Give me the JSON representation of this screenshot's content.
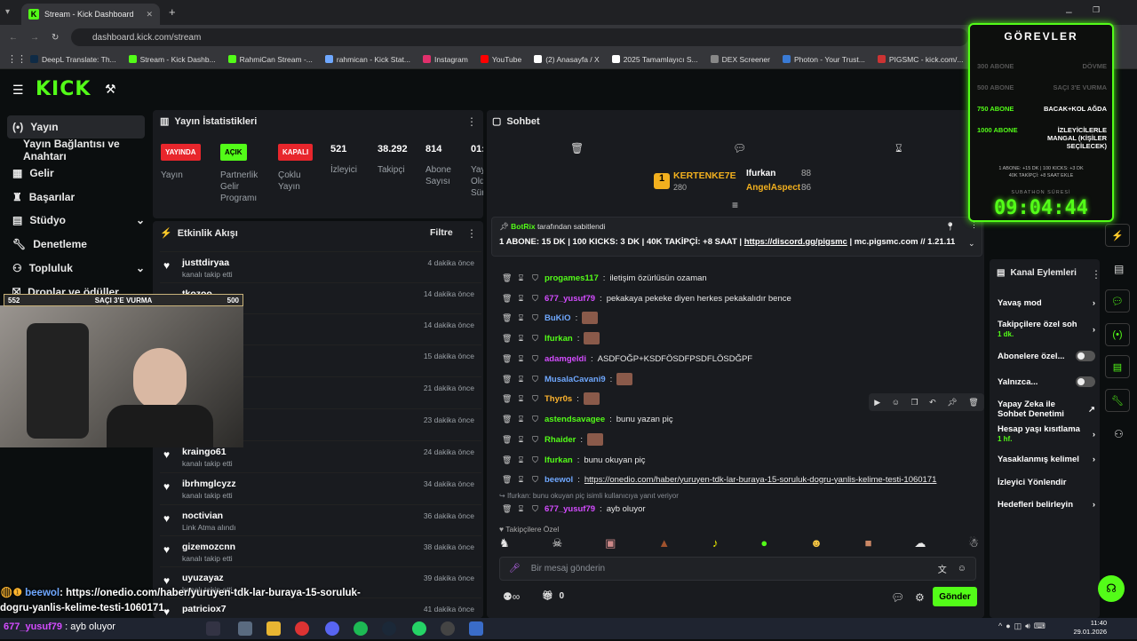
{
  "browser": {
    "tab_title": "Stream - Kick Dashboard",
    "url": "dashboard.kick.com/stream",
    "bookmarks": [
      "DeepL Translate: Th...",
      "Stream - Kick Dashb...",
      "RahmiCan Stream -...",
      "rahmican - Kick Stat...",
      "Instagram",
      "YouTube",
      "(2) Anasayfa / X",
      "2025 Tamamlayıcı S...",
      "DEX Screener",
      "Photon - Your Trust...",
      "PIGSMC - kick.com/...",
      "uxento"
    ]
  },
  "nav": {
    "items": [
      "Yayın",
      "Yayın Bağlantısı ve Anahtarı",
      "Gelir",
      "Başarılar",
      "Stüdyo",
      "Denetleme",
      "Topluluk",
      "Droplar ve ödüller"
    ]
  },
  "stats": {
    "title": "Yayın İstatistikleri",
    "yayinda": "YAYINDA",
    "yayin": "Yayın",
    "acik": "AÇIK",
    "partner": "Partnerlik Gelir Programı",
    "kapali": "KAPALI",
    "coklu": "Çoklu Yayın",
    "izleyici_val": "521",
    "izleyici": "İzleyici",
    "takipci_val": "38.292",
    "takipci": "Takipçi",
    "abone_val": "814",
    "abone": "Abone Sayısı",
    "extra_val": "01:",
    "extra": "Yay Old Sür"
  },
  "activity": {
    "title": "Etkinlik Akışı",
    "filter": "Filtre",
    "items": [
      {
        "name": "justtdiryaa",
        "sub": "kanalı takip etti",
        "time": "4 dakika önce"
      },
      {
        "name": "tkozoo",
        "sub": "",
        "time": "14 dakika önce"
      },
      {
        "name": "nera",
        "sub": "",
        "time": "14 dakika önce"
      },
      {
        "name": "",
        "sub": "",
        "time": "15 dakika önce"
      },
      {
        "name": "",
        "sub": "",
        "time": "21 dakika önce"
      },
      {
        "name": "",
        "sub": "",
        "time": "23 dakika önce"
      },
      {
        "name": "kraingo61",
        "sub": "kanalı takip etti",
        "time": "24 dakika önce"
      },
      {
        "name": "ibrhmglcyzz",
        "sub": "kanalı takip etti",
        "time": "34 dakika önce"
      },
      {
        "name": "noctivian",
        "sub": "Link Atma alındı",
        "time": "36 dakika önce"
      },
      {
        "name": "gizemozcnn",
        "sub": "kanalı takip etti",
        "time": "38 dakika önce"
      },
      {
        "name": "uyuzayaz",
        "sub": "kanalı takip etti",
        "time": "39 dakika önce"
      },
      {
        "name": "patriciox7",
        "sub": "",
        "time": "41 dakika önce"
      }
    ]
  },
  "chat": {
    "title": "Sohbet",
    "top": {
      "leader": "KERTENKE7E",
      "leader_val": "280",
      "second": "Ifurkan",
      "second_val": "88",
      "third": "AngelAspect",
      "third_val": "86"
    },
    "pinned": {
      "by": "BotRix",
      "by_suffix": "tarafından sabitlendi",
      "text": "1 ABONE: 15 DK | 100 KICKS: 3 DK | 40K TAKİPÇİ: +8 SAAT |",
      "link": "https://discord.gg/pigsmc",
      "tail": "| mc.pigsmc.com // 1.21.11"
    },
    "messages": [
      {
        "user": "progames117",
        "color": "#53fc18",
        "text": "iletişim özürlüsün ozaman"
      },
      {
        "user": "677_yusuf79",
        "color": "#d44cff",
        "text": "pekakaya pekeke diyen herkes pekakalıdır bence"
      },
      {
        "user": "BuKiO",
        "color": "#6fa8ff",
        "text": ""
      },
      {
        "user": "Ifurkan",
        "color": "#53fc18",
        "text": ""
      },
      {
        "user": "adamgeldi",
        "color": "#d44cff",
        "text": "ASDFOĞP+KSDFÖSDFPSDFLÖSDĞPF"
      },
      {
        "user": "MusalaCavani9",
        "color": "#6fa8ff",
        "text": ""
      },
      {
        "user": "Thyr0s",
        "color": "#ffb52e",
        "text": ""
      },
      {
        "user": "astendsavagee",
        "color": "#53fc18",
        "text": "bunu yazan piç"
      },
      {
        "user": "Rhaider",
        "color": "#53fc18",
        "text": ""
      },
      {
        "user": "Ifurkan",
        "color": "#53fc18",
        "text": "bunu okuyan piç"
      },
      {
        "user": "beewol",
        "color": "#6fa8ff",
        "text": "https://onedio.com/haber/yuruyen-tdk-lar-buraya-15-soruluk-dogru-yanlis-kelime-testi-1060171"
      },
      {
        "user": "677_yusuf79",
        "color": "#d44cff",
        "text": "ayb oluyor"
      }
    ],
    "reply_note": "Ifurkan: bunu okuyan piç isimli kullanıcıya yanıt veriyor",
    "followers_only": "Takipçilere Özel",
    "input_placeholder": "Bir mesaj gönderin",
    "send": "Gönder",
    "count": "0"
  },
  "channel_actions": {
    "title": "Kanal Eylemleri",
    "items": [
      "Yavaş mod",
      "Takipçilere özel soh",
      "Abonelere özel...",
      "Yalnızca...",
      "Yapay Zeka ile Sohbet Denetimi",
      "Hesap yaşı kısıtlama",
      "Yasaklanmış kelimel",
      "İzleyici Yönlendir",
      "Hedefleri belirleyin"
    ],
    "takip_sub": "1 dk.",
    "hesap_sub": "1 hf."
  },
  "gorevler": {
    "title": "GÖREVLER",
    "rows": [
      {
        "goal": "300 ABONE",
        "task": "DÖVME"
      },
      {
        "goal": "500 ABONE",
        "task": "SAÇI 3'E VURMA"
      },
      {
        "goal": "750 ABONE",
        "task": "BACAK+KOL AĞDA"
      },
      {
        "goal": "1000 ABONE",
        "task": "İZLEYİCİLERLE MANGAL (KİŞİLER SEÇİLECEK)"
      }
    ],
    "note1": "1 ABONE: +15 DK | 100 KICKS: +3 DK",
    "note2": "40K TAKİPÇİ: +8 SAAT EKLE",
    "timer_label": "SUBATHON SÜRESİ",
    "timer": "09:04:44"
  },
  "overlay": {
    "count": "552",
    "label": "SAÇI 3'E VURMA",
    "goal": "500",
    "ticker_user": "beewol",
    "ticker_text": "https://onedio.com/haber/yuruyen-tdk-lar-buraya-15-soruluk-dogru-yanlis-kelime-testi-1060171",
    "ticker2_user": "677_yusuf79",
    "ticker2_text": "ayb oluyor"
  },
  "taskbar": {
    "time": "11:40",
    "date": "29.01.2026"
  }
}
